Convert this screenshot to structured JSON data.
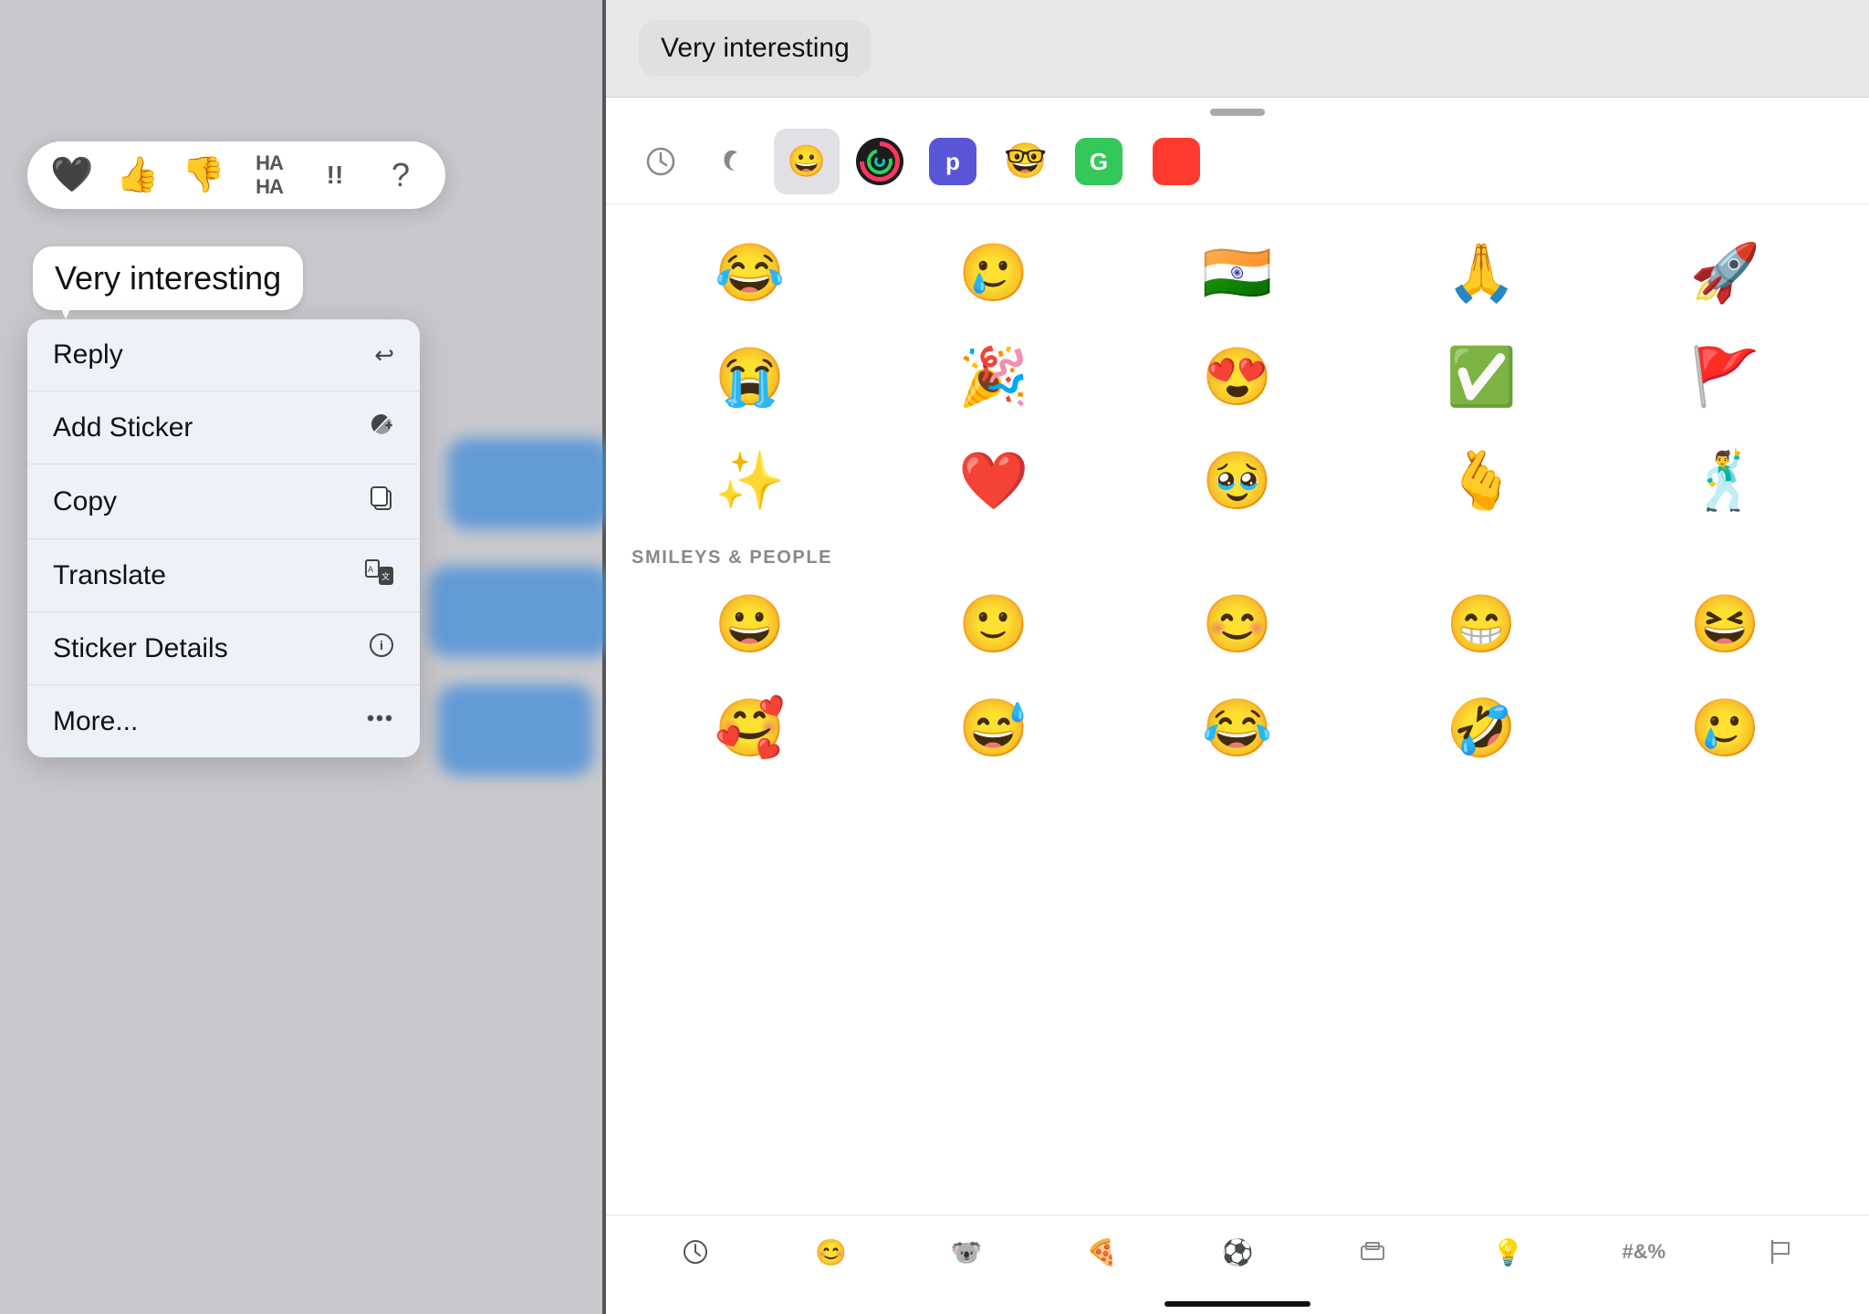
{
  "left": {
    "message_text": "Very interesting",
    "reactions": [
      {
        "emoji": "🖤",
        "label": "heart"
      },
      {
        "emoji": "👍",
        "label": "thumbs-up"
      },
      {
        "emoji": "👎",
        "label": "thumbs-down"
      },
      {
        "emoji": "HAHA",
        "label": "haha",
        "text": true
      },
      {
        "emoji": "!!",
        "label": "exclamation",
        "text": true
      },
      {
        "emoji": "?",
        "label": "question",
        "text": true
      }
    ],
    "menu_items": [
      {
        "label": "Reply",
        "icon": "↩",
        "id": "reply"
      },
      {
        "label": "Add Sticker",
        "icon": "🗂",
        "id": "add-sticker"
      },
      {
        "label": "Copy",
        "icon": "📋",
        "id": "copy"
      },
      {
        "label": "Translate",
        "icon": "🔤",
        "id": "translate"
      },
      {
        "label": "Sticker Details",
        "icon": "ℹ",
        "id": "sticker-details"
      },
      {
        "label": "More...",
        "icon": "···",
        "id": "more"
      }
    ]
  },
  "right": {
    "preview_text": "Very interesting",
    "category_tabs": [
      {
        "type": "recent",
        "label": "🕐"
      },
      {
        "type": "moon",
        "label": "🌙"
      },
      {
        "type": "emoji",
        "label": "😀",
        "active": true
      },
      {
        "type": "activity",
        "label": "⊕"
      },
      {
        "type": "purple",
        "label": "P"
      },
      {
        "type": "avatar",
        "label": "🤓"
      },
      {
        "type": "green",
        "label": "G"
      }
    ],
    "featured_emojis": [
      "😂",
      "🥲",
      "🇮🇳",
      "🙏",
      "🚀",
      "😭",
      "🎉",
      "😍",
      "✅",
      "🚩",
      "✨",
      "❤️",
      "🥹",
      "🫰",
      "🕺"
    ],
    "section_label": "SMILEYS & PEOPLE",
    "smileys": [
      "😀",
      "🙂",
      "😊",
      "😁",
      "😆",
      "🥰",
      "😅",
      "😂",
      "🤣",
      "🥲"
    ],
    "bottom_tabs": [
      {
        "icon": "🕐",
        "label": "recent",
        "active": true
      },
      {
        "icon": "😊",
        "label": "smileys"
      },
      {
        "icon": "🐨",
        "label": "animals"
      },
      {
        "icon": "🍕",
        "label": "food"
      },
      {
        "icon": "⚽",
        "label": "activities"
      },
      {
        "icon": "🏛",
        "label": "travel"
      },
      {
        "icon": "💡",
        "label": "objects"
      },
      {
        "icon": "#",
        "label": "symbols"
      },
      {
        "icon": "🚩",
        "label": "flags"
      }
    ]
  }
}
